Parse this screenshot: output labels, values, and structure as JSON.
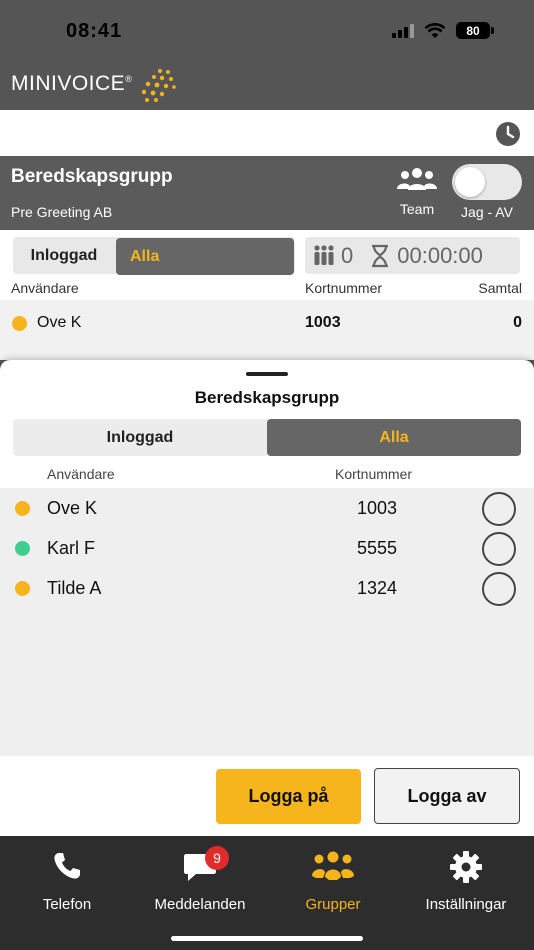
{
  "status_bar": {
    "time": "08:41",
    "battery": "80"
  },
  "brand": {
    "name": "MINIVOICE",
    "mark": "®"
  },
  "group": {
    "title": "Beredskapsgrupp",
    "company": "Pre Greeting AB",
    "team_label": "Team",
    "toggle_label": "Jag - AV"
  },
  "filter": {
    "logged_in_label": "Inloggad",
    "all_label": "Alla",
    "queue_count": "0",
    "wait_time": "00:00:00"
  },
  "top_table": {
    "headers": {
      "user": "Användare",
      "card": "Kortnummer",
      "calls": "Samtal"
    },
    "rows": [
      {
        "name": "Ove K",
        "card": "1003",
        "calls": "0",
        "status_color": "#f5b41c"
      }
    ]
  },
  "sheet": {
    "title": "Beredskapsgrupp",
    "seg_logged_in": "Inloggad",
    "seg_all": "Alla",
    "headers": {
      "user": "Användare",
      "card": "Kortnummer"
    },
    "rows": [
      {
        "name": "Ove K",
        "card": "1003",
        "status_color": "#f5b41c"
      },
      {
        "name": "Karl F",
        "card": "5555",
        "status_color": "#3ecf8e"
      },
      {
        "name": "Tilde A",
        "card": "1324",
        "status_color": "#f5b41c"
      }
    ],
    "login_label": "Logga på",
    "logout_label": "Logga av"
  },
  "tabs": [
    {
      "label": "Telefon",
      "icon": "phone-icon"
    },
    {
      "label": "Meddelanden",
      "icon": "message-icon",
      "badge": "9"
    },
    {
      "label": "Grupper",
      "icon": "groups-icon",
      "active": true
    },
    {
      "label": "Inställningar",
      "icon": "gear-icon"
    }
  ],
  "colors": {
    "accent": "#f5b41c",
    "online": "#3ecf8e",
    "badge": "#e12a2a"
  }
}
